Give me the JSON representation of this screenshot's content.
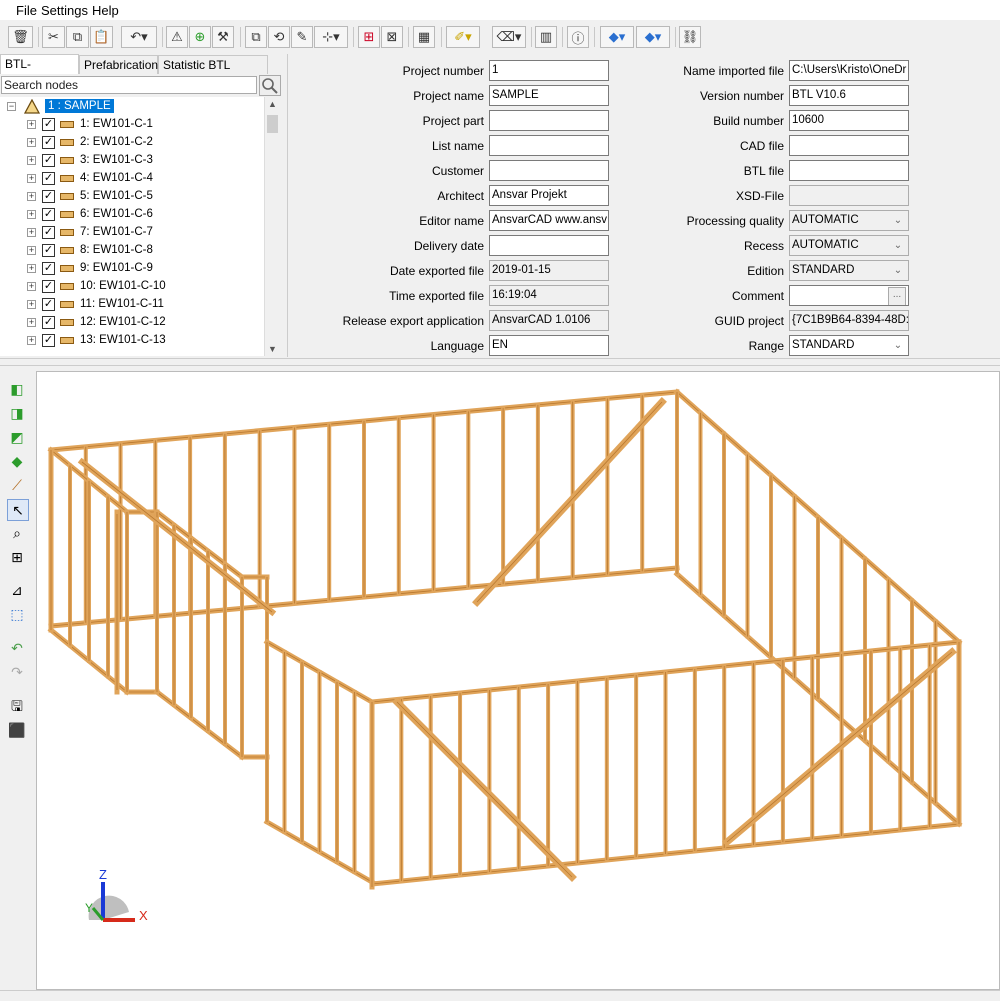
{
  "menu": {
    "file": "File",
    "settings": "Settings",
    "help": "Help"
  },
  "tabs": [
    "BTL-Standard",
    "Prefabrication",
    "Statistic BTL content"
  ],
  "search": {
    "placeholder": "Search nodes"
  },
  "tree": {
    "root": "1 : SAMPLE",
    "items": [
      "1: EW101-C-1",
      "2: EW101-C-2",
      "3: EW101-C-3",
      "4: EW101-C-4",
      "5: EW101-C-5",
      "6: EW101-C-6",
      "7: EW101-C-7",
      "8: EW101-C-8",
      "9: EW101-C-9",
      "10: EW101-C-10",
      "11: EW101-C-11",
      "12: EW101-C-12",
      "13: EW101-C-13"
    ]
  },
  "props_left": [
    {
      "label": "Project number",
      "value": "1",
      "readonly": false
    },
    {
      "label": "Project name",
      "value": "SAMPLE",
      "readonly": false
    },
    {
      "label": "Project part",
      "value": "",
      "readonly": false
    },
    {
      "label": "List name",
      "value": "",
      "readonly": false
    },
    {
      "label": "Customer",
      "value": "",
      "readonly": false
    },
    {
      "label": "Architect",
      "value": "Ansvar Projekt",
      "readonly": false
    },
    {
      "label": "Editor name",
      "value": "AnsvarCAD www.ansv",
      "readonly": false
    },
    {
      "label": "Delivery date",
      "value": "",
      "readonly": false
    },
    {
      "label": "Date exported file",
      "value": "2019-01-15",
      "readonly": true
    },
    {
      "label": "Time exported file",
      "value": "16:19:04",
      "readonly": true
    },
    {
      "label": "Release export application",
      "value": "AnsvarCAD 1.0106",
      "readonly": true
    },
    {
      "label": "Language",
      "value": "EN",
      "readonly": false
    }
  ],
  "props_right": [
    {
      "label": "Name imported file",
      "value": "C:\\Users\\Kristo\\OneDr",
      "readonly": false,
      "dropdown": false
    },
    {
      "label": "Version number",
      "value": "BTL V10.6",
      "readonly": false,
      "dropdown": false
    },
    {
      "label": "Build number",
      "value": "10600",
      "readonly": false,
      "dropdown": false
    },
    {
      "label": "CAD file",
      "value": "",
      "readonly": false,
      "dropdown": false
    },
    {
      "label": "BTL file",
      "value": "",
      "readonly": false,
      "dropdown": false
    },
    {
      "label": "XSD-File",
      "value": "",
      "readonly": true,
      "dropdown": false
    },
    {
      "label": "Processing quality",
      "value": "AUTOMATIC",
      "readonly": true,
      "dropdown": true
    },
    {
      "label": "Recess",
      "value": "AUTOMATIC",
      "readonly": true,
      "dropdown": true
    },
    {
      "label": "Edition",
      "value": "STANDARD",
      "readonly": true,
      "dropdown": true
    },
    {
      "label": "Comment",
      "value": "",
      "readonly": false,
      "dropdown": false,
      "ellipsis": "..."
    },
    {
      "label": "GUID project",
      "value": "{7C1B9B64-8394-48D:",
      "readonly": true,
      "dropdown": false
    },
    {
      "label": "Range",
      "value": "STANDARD",
      "readonly": false,
      "dropdown": true
    }
  ],
  "axes": {
    "z": "Z",
    "x": "X",
    "y": "Y"
  },
  "colors": {
    "selection": "#0078d7",
    "timber": "#e0a45a",
    "timber_dark": "#a8661e"
  }
}
